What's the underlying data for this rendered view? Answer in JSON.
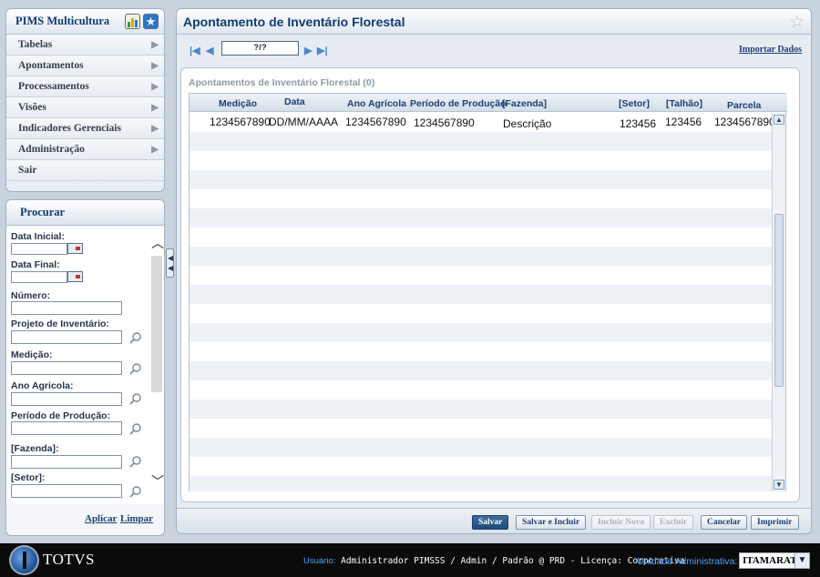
{
  "sidebar": {
    "title": "PIMS Multicultura",
    "icons": [
      "bar-chart-icon",
      "star-badge-icon"
    ],
    "items": [
      {
        "label": "Tabelas"
      },
      {
        "label": "Apontamentos"
      },
      {
        "label": "Processamentos"
      },
      {
        "label": "Visões"
      },
      {
        "label": "Indicadores Gerenciais"
      },
      {
        "label": "Administração"
      },
      {
        "label": "Sair"
      }
    ]
  },
  "search": {
    "title": "Procurar",
    "fields": {
      "data_inicial": "Data Inicial:",
      "data_final": "Data Final:",
      "numero": "Número:",
      "projeto": "Projeto de Inventário:",
      "medicao": "Medição:",
      "ano_agricola": " Ano Agricola:",
      "periodo": "Período de Produção:",
      "fazenda": "[Fazenda]:",
      "setor": "[Setor]:"
    },
    "apply_label": "Aplicar",
    "clear_label": "Limpar"
  },
  "main": {
    "title": "Apontamento de Inventário Florestal",
    "pager": "?/?",
    "import_label": "Importar Dados",
    "grid_caption": "Apontamentos de Inventário Florestal (0)",
    "columns": [
      "Medição",
      "Data",
      "Ano Agrícola",
      "Período de Produção",
      "[Fazenda]",
      "[Setor]",
      "[Talhão]",
      "Parcela"
    ],
    "rows": [
      [
        "1234567890",
        "DD/MM/AAAA",
        "1234567890",
        "1234567890",
        "Descrição",
        "123456",
        "123456",
        "1234567890"
      ]
    ]
  },
  "actions": {
    "salvar": "Salvar",
    "salvar_incluir": "Salvar e Incluir",
    "incluir_novo": "Incluir Novo",
    "excluir": "Excluir",
    "cancelar": "Cancelar",
    "imprimir": "Imprimir"
  },
  "footer": {
    "logo": "TOTVS",
    "user_label": "Usuário:",
    "user_value": " Administrador PIMSSS / Admin / Padrão @ PRD - Licença: Corporativa",
    "unit_label": "Unidade Administrativa:",
    "unit_value": "ITAMARATI"
  },
  "colors": {
    "accent": "#0f3b73",
    "link": "#1c3f75",
    "primary_button": "#1f4a78",
    "footer_label": "#4aa3ff"
  }
}
